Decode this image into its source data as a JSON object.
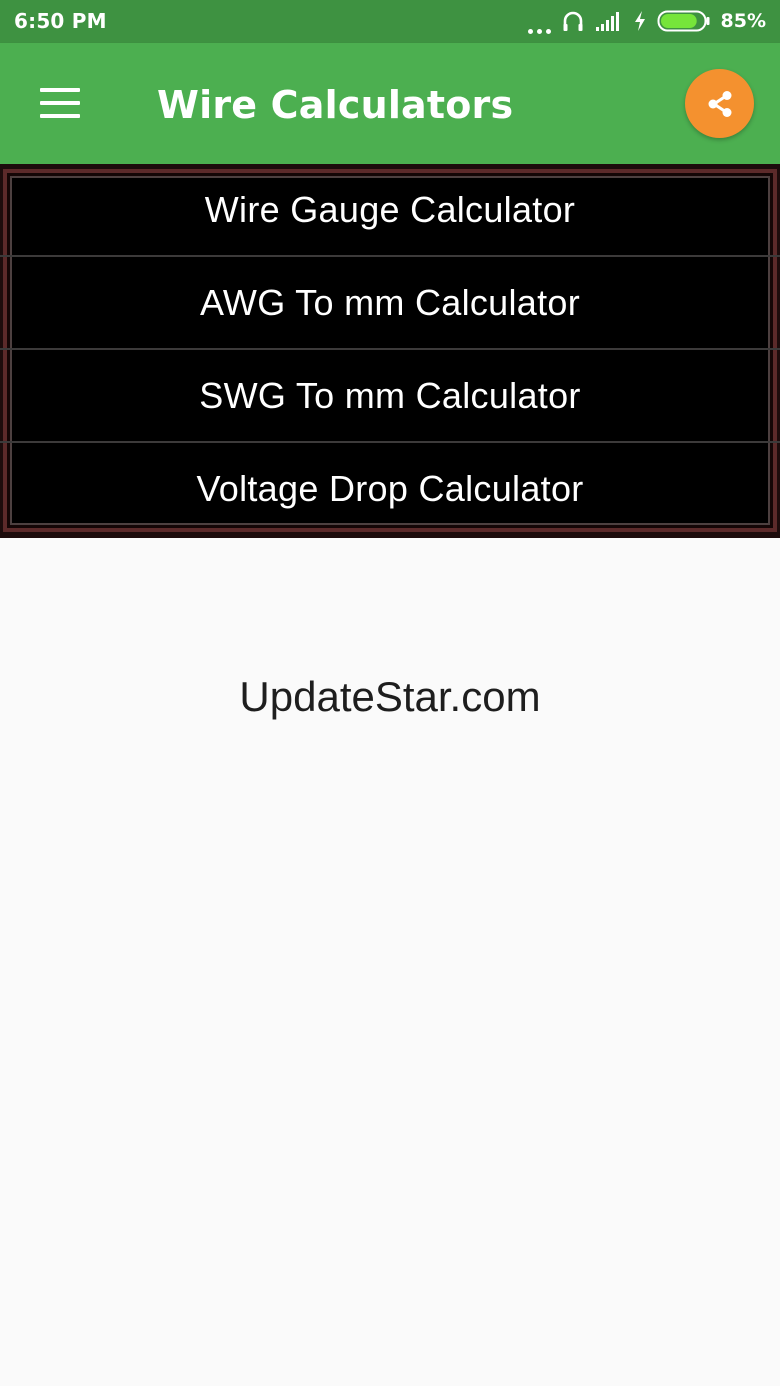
{
  "status_bar": {
    "time": "6:50 PM",
    "battery_percent": "85%",
    "battery_level": 0.85,
    "icons": [
      "more-dots-icon",
      "headphones-icon",
      "signal-icon",
      "charging-icon",
      "battery-icon"
    ]
  },
  "app_bar": {
    "title": "Wire Calculators",
    "menu_icon": "hamburger-menu-icon",
    "share_icon": "share-icon",
    "colors": {
      "app_bar": "#4caf50",
      "status_bar": "#3e9241",
      "fab": "#f4912f"
    }
  },
  "calculators": {
    "items": [
      {
        "label": "Wire Gauge Calculator"
      },
      {
        "label": "AWG To mm Calculator"
      },
      {
        "label": "SWG To mm Calculator"
      },
      {
        "label": "Voltage Drop Calculator"
      }
    ]
  },
  "watermark": {
    "text": "UpdateStar.com"
  }
}
